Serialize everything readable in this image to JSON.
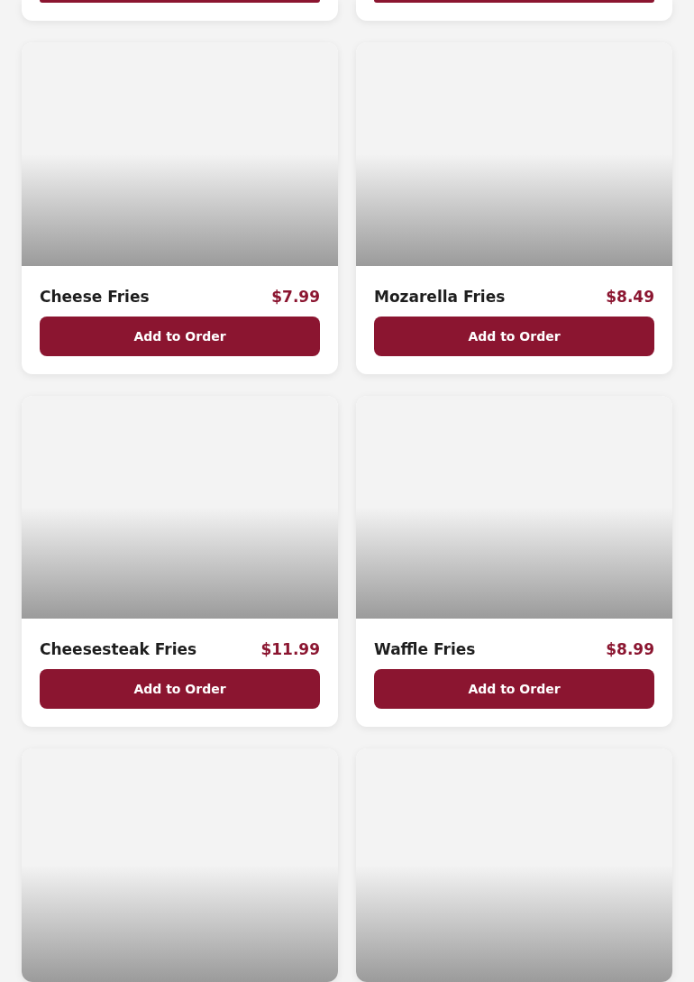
{
  "menu_items": [
    {
      "kind": "cut_bottom"
    },
    {
      "kind": "cut_bottom"
    },
    {
      "kind": "full",
      "name": "Cheese Fries",
      "price": "$7.99",
      "button": "Add to Order"
    },
    {
      "kind": "full",
      "name": "Mozarella Fries",
      "price": "$8.49",
      "button": "Add to Order"
    },
    {
      "kind": "full",
      "name": "Cheesesteak Fries",
      "price": "$11.99",
      "button": "Add to Order"
    },
    {
      "kind": "full",
      "name": "Waffle Fries",
      "price": "$8.99",
      "button": "Add to Order"
    },
    {
      "kind": "cut_top"
    },
    {
      "kind": "cut_top"
    }
  ]
}
